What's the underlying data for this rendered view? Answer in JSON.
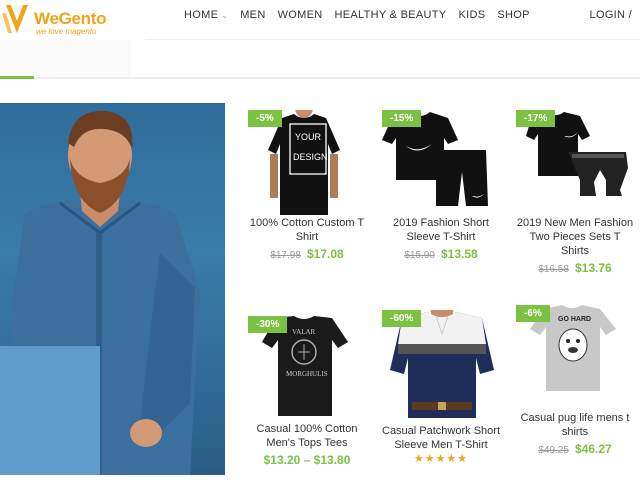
{
  "brand": {
    "name": "WeGento",
    "tagline": "we love magento"
  },
  "nav": [
    {
      "label": "HOME",
      "has_dropdown": true
    },
    {
      "label": "MEN"
    },
    {
      "label": "WOMEN"
    },
    {
      "label": "HEALTHY & BEAUTY"
    },
    {
      "label": "KIDS"
    },
    {
      "label": "SHOP"
    }
  ],
  "login_label": "LOGIN /",
  "products": [
    {
      "badge": "-5%",
      "name": "100% Cotton Custom T Shirt",
      "old_price": "$17.98",
      "price": "$17.08"
    },
    {
      "badge": "-15%",
      "name": "2019 Fashion Short Sleeve T-Shirt",
      "old_price": "$15.90",
      "price": "$13.58"
    },
    {
      "badge": "-17%",
      "name": "2019 New Men Fashion Two Pieces Sets T Shirts",
      "old_price": "$16.58",
      "price": "$13.76"
    },
    {
      "badge": "-30%",
      "name": "Casual 100% Cotton Men's Tops Tees",
      "price_range": "$13.20 – $13.80"
    },
    {
      "badge": "-60%",
      "name": "Casual Patchwork Short Sleeve Men T-Shirt",
      "rating": "★★★★★"
    },
    {
      "badge": "-6%",
      "name": "Casual pug life mens t shirts",
      "old_price": "$49.25",
      "price": "$46.27"
    }
  ],
  "shirt_prints": {
    "p1": [
      "YOUR",
      "DESIGN"
    ],
    "p4": [
      "VALAR",
      "MORGHULIS"
    ],
    "p6": [
      "GO HARD"
    ]
  },
  "colors": {
    "accent": "#7cc242",
    "brand": "#f0a31c"
  }
}
